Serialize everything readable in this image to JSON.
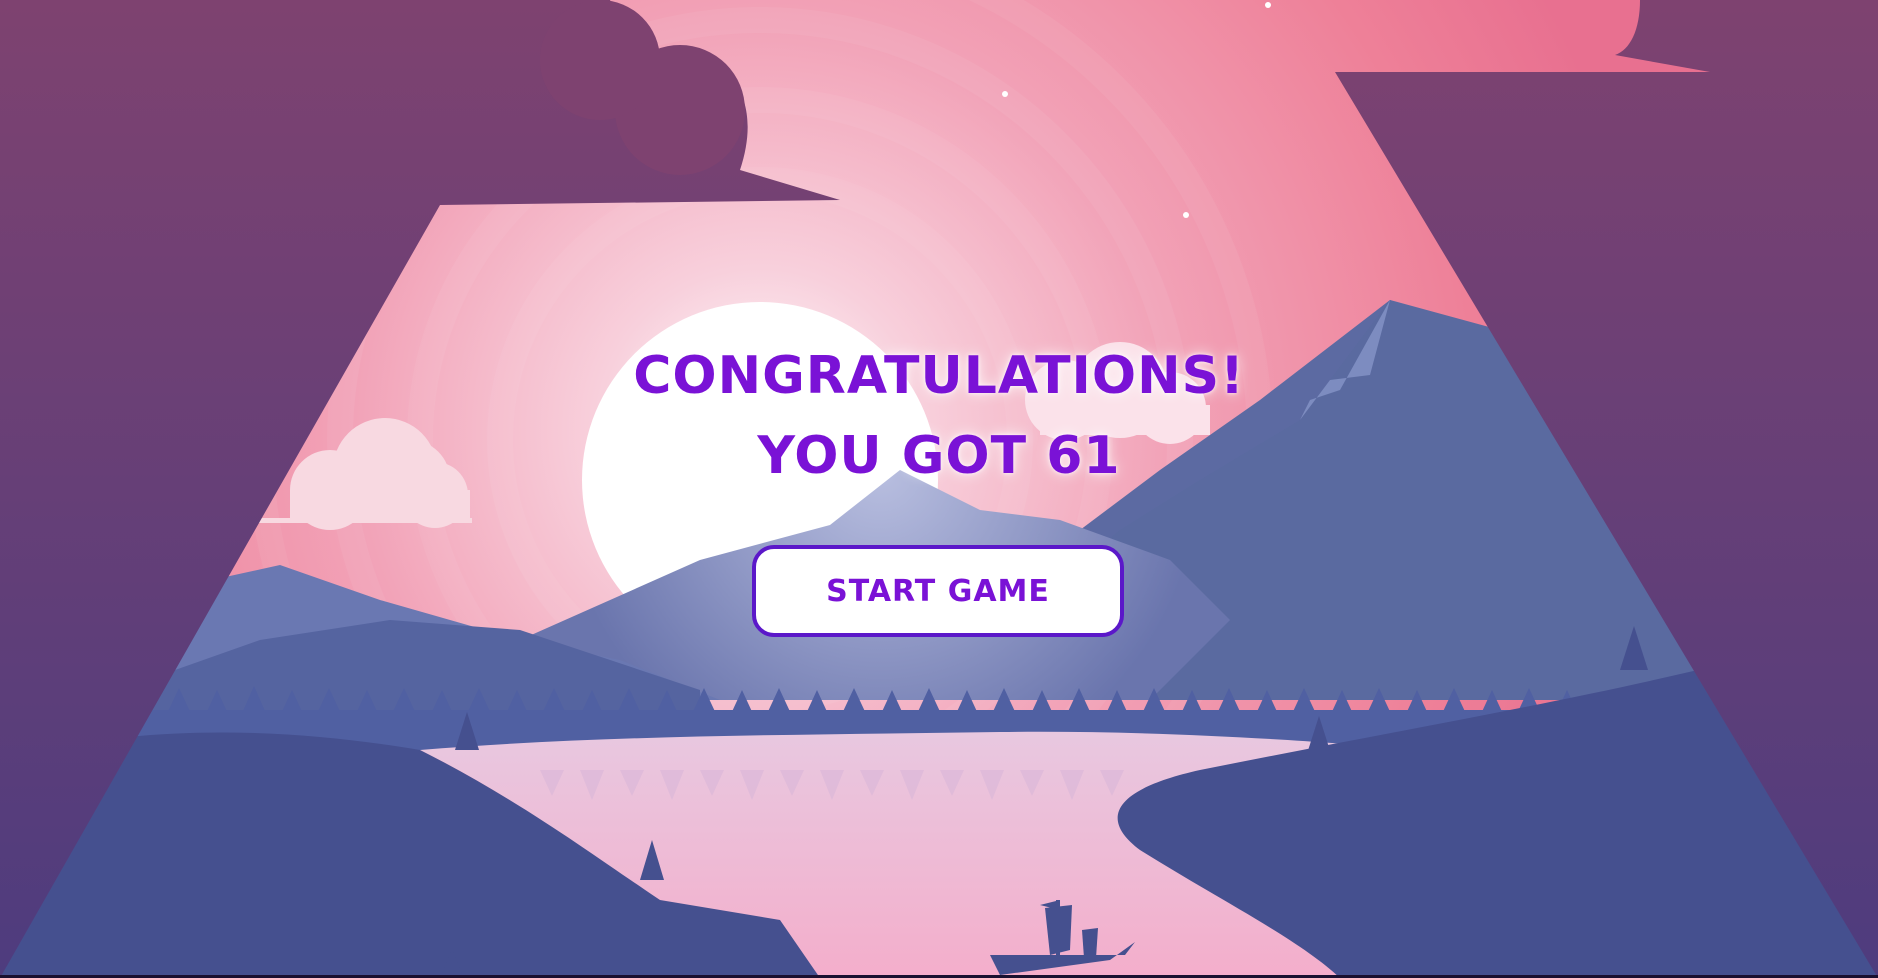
{
  "result": {
    "title": "Congratulations!",
    "score_text": "You got 61"
  },
  "actions": {
    "start_label": "Start game"
  },
  "colors": {
    "text_purple": "#7a12d6",
    "button_border": "#5b18c9",
    "frame": "#6a3c72",
    "sky_pink": "#f08aa0",
    "mountain": "#5a6aa0",
    "ground": "#45508f",
    "lake": "#f1b5cc"
  }
}
